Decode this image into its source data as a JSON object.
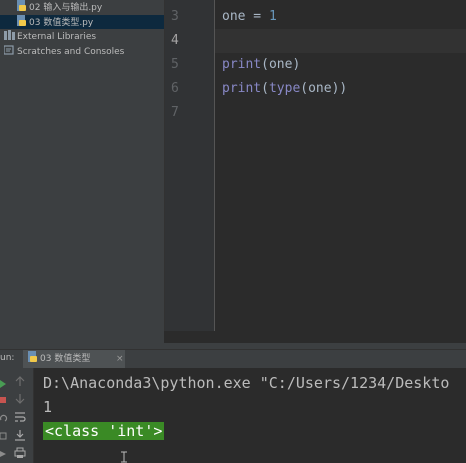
{
  "project_tree": {
    "items": [
      {
        "label": "02 输入与输出.py",
        "icon": "python-file-icon",
        "selected": false
      },
      {
        "label": "03 数值类型.py",
        "icon": "python-file-icon",
        "selected": true
      },
      {
        "label": "External Libraries",
        "icon": "library-icon",
        "selected": false
      },
      {
        "label": "Scratches and Consoles",
        "icon": "scratches-icon",
        "selected": false
      }
    ]
  },
  "editor": {
    "line_numbers": [
      "3",
      "4",
      "5",
      "6",
      "7"
    ],
    "current_line": "4",
    "lines": [
      {
        "line": "3",
        "tokens": [
          "one",
          " = ",
          "1"
        ]
      },
      {
        "line": "4",
        "tokens": []
      },
      {
        "line": "5",
        "tokens": [
          "print",
          "(",
          "one",
          ")"
        ]
      },
      {
        "line": "6",
        "tokens": [
          "print",
          "(",
          "type",
          "(",
          "one",
          "))"
        ]
      },
      {
        "line": "7",
        "tokens": []
      }
    ]
  },
  "run_panel": {
    "label": "un:",
    "tab_label": "03 数值类型",
    "tab_close": "×",
    "console": {
      "command": "D:\\Anaconda3\\python.exe \"C:/Users/1234/Deskto",
      "output_1": "1",
      "output_2": "<class 'int'>"
    }
  },
  "colors": {
    "background": "#2b2b2b",
    "panel": "#3c3f41",
    "selection": "#0d293e",
    "number": "#6897bb",
    "builtin": "#8888c6",
    "identifier": "#a9b7c6",
    "highlight": "#3a8a25"
  }
}
